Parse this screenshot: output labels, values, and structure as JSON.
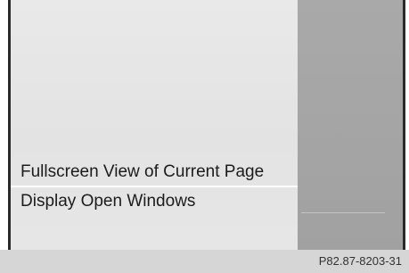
{
  "menu": {
    "items": [
      {
        "label": "Fullscreen View of Current Page"
      },
      {
        "label": "Display Open Windows"
      }
    ]
  },
  "footer": {
    "figure_code": "P82.87-8203-31"
  },
  "colors": {
    "menu_background": "#e6e6e6",
    "side_panel": "#a5a5a5",
    "footer_bar": "#d6d6d6",
    "text": "#1c1c1c"
  }
}
